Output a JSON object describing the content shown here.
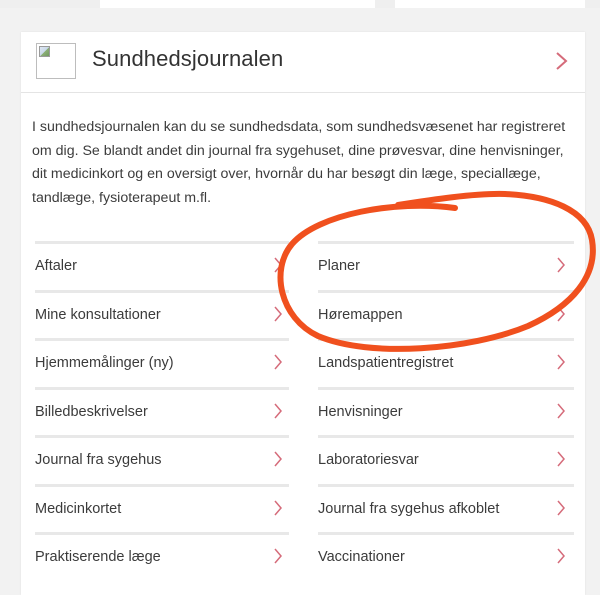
{
  "card": {
    "title": "Sundhedsjournalen",
    "image_alt": "",
    "header_icon": "chevron-right-icon",
    "description": "I sundhedsjournalen kan du se sundhedsdata, som sundhedsvæsenet har registreret om dig. Se blandt andet din journal fra sygehuset, dine prøvesvar, dine henvisninger, dit medicinkort og en oversigt over, hvornår du har besøgt din læge, speciallæge, tandlæge, fysioterapeut m.fl."
  },
  "links": {
    "left": [
      {
        "label": "Aftaler"
      },
      {
        "label": "Mine konsultationer"
      },
      {
        "label": "Hjemmemålinger (ny)"
      },
      {
        "label": "Billedbeskrivelser"
      },
      {
        "label": "Journal fra sygehus"
      },
      {
        "label": "Medicinkortet"
      },
      {
        "label": "Praktiserende læge"
      }
    ],
    "right": [
      {
        "label": "Planer"
      },
      {
        "label": "Høremappen"
      },
      {
        "label": "Landspatientregistret"
      },
      {
        "label": "Henvisninger"
      },
      {
        "label": "Laboratoriesvar"
      },
      {
        "label": "Journal fra sygehus afkoblet"
      },
      {
        "label": "Vaccinationer"
      }
    ]
  },
  "colors": {
    "chevron": "#d56b7a",
    "annotation": "#f0501e",
    "divider": "#e8e8e8",
    "text": "#3b3b3b"
  },
  "annotation": {
    "shape": "hand-drawn-ellipse",
    "encloses": [
      "Planer",
      "Høremappen"
    ]
  }
}
